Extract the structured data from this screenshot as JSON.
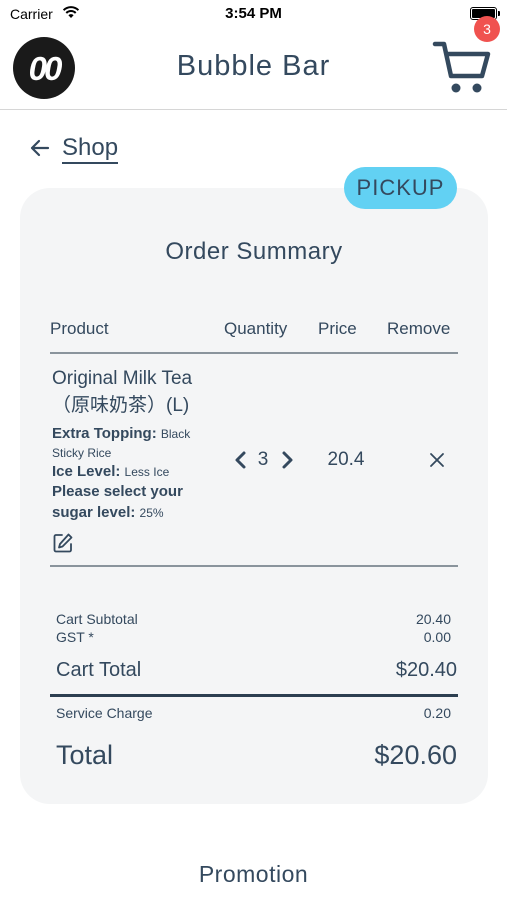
{
  "status_bar": {
    "carrier": "Carrier",
    "time": "3:54 PM"
  },
  "header": {
    "logo_text": "00",
    "title": "Bubble Bar",
    "cart_count": "3"
  },
  "nav": {
    "back_label": "Shop"
  },
  "order": {
    "fulfillment_badge": "PICKUP",
    "title": "Order Summary",
    "columns": [
      "Product",
      "Quantity",
      "Price",
      "Remove"
    ],
    "item": {
      "name_line1": "Original Milk Tea",
      "name_line2": "（原味奶茶）(L)",
      "topping_label": "Extra Topping:",
      "topping_value_1": "Black",
      "topping_value_2": "Sticky Rice",
      "ice_label": "Ice Level:",
      "ice_value": "Less Ice",
      "sugar_label_1": "Please select your",
      "sugar_label_2": "sugar level:",
      "sugar_value": "25%",
      "quantity": "3",
      "price": "20.4"
    },
    "summary": {
      "subtotal_label": "Cart Subtotal",
      "subtotal_value": "20.40",
      "gst_label": "GST *",
      "gst_value": "0.00",
      "cart_total_label": "Cart Total",
      "cart_total_value": "$20.40",
      "service_label": "Service Charge",
      "service_value": "0.20",
      "total_label": "Total",
      "total_value": "$20.60"
    }
  },
  "promotion": {
    "title": "Promotion"
  },
  "colors": {
    "text": "#34495e",
    "card_bg": "#f4f5f6",
    "pickup_badge": "#62d1f3",
    "cart_badge": "#f0524f",
    "rule": "#8a949c"
  },
  "icons": [
    "wifi-icon",
    "battery-icon",
    "cart-icon",
    "back-arrow-icon",
    "chevron-left-icon",
    "chevron-right-icon",
    "close-icon",
    "edit-icon"
  ]
}
